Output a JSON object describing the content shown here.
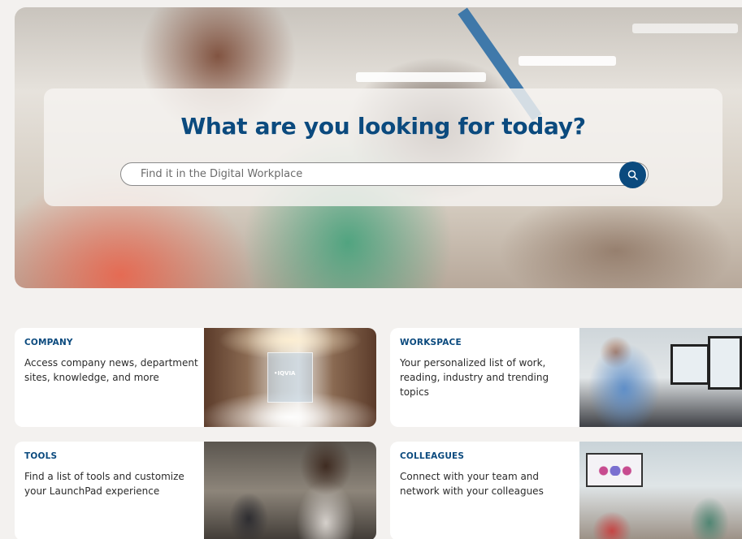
{
  "hero": {
    "title": "What are you looking for today?",
    "search_placeholder": "Find it in the Digital Workplace",
    "search_icon": "search-icon"
  },
  "cards": [
    {
      "title": "COMPANY",
      "description": "Access company news, department sites, knowledge, and more",
      "image_text": "•IQVIA"
    },
    {
      "title": "WORKSPACE",
      "description": "Your personalized list of work, reading, industry and trending topics"
    },
    {
      "title": "TOOLS",
      "description": "Find a list of tools and customize your LaunchPad experience"
    },
    {
      "title": "COLLEAGUES",
      "description": "Connect with your team and network with your colleagues"
    }
  ],
  "colors": {
    "accent": "#0b4a7e",
    "background": "#f3f1ef"
  }
}
